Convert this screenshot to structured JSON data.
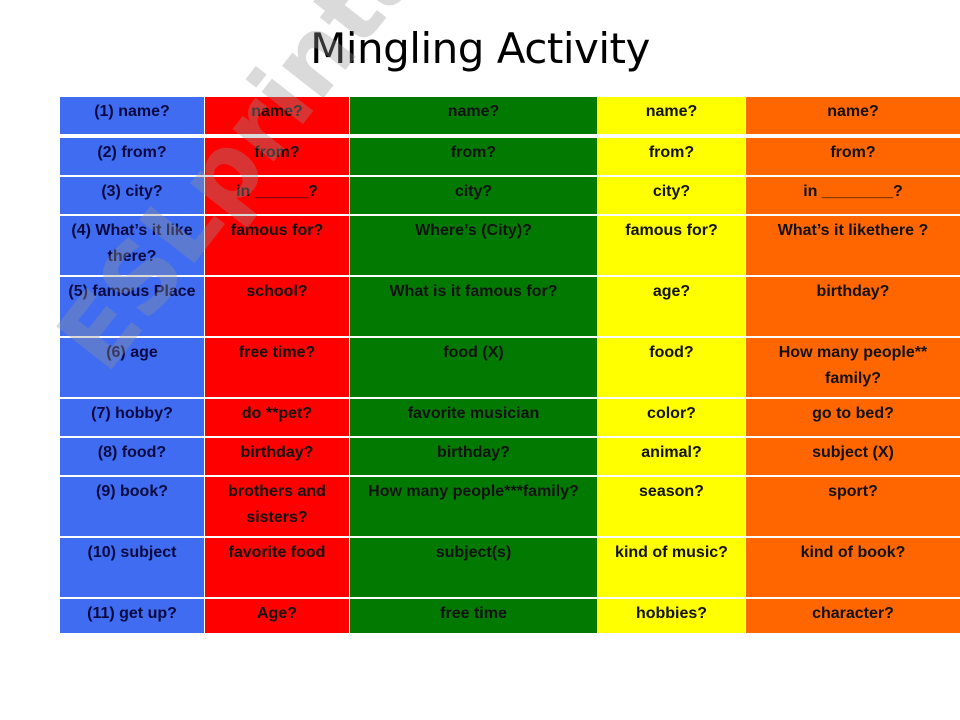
{
  "title": "Mingling Activity",
  "watermark": "ESLprintables.com",
  "colors": {
    "column_1": "#3f6cf1",
    "column_2": "#fe0000",
    "column_3": "#027a02",
    "column_4": "#ffff00",
    "column_5": "#ff6600"
  },
  "table": {
    "rows": [
      [
        "(1) name?",
        "name?",
        "name?",
        "name?",
        "name?"
      ],
      [
        "(2) from?",
        "from?",
        "from?",
        "from?",
        "from?"
      ],
      [
        "(3) city?",
        "in ______?",
        "city?",
        "city?",
        "in ________?"
      ],
      [
        "(4) What’s it like there?",
        "famous for?",
        "Where’s (City)?",
        "famous for?",
        "What’s it likethere  ?"
      ],
      [
        "(5) famous Place",
        "school?",
        "What is it famous for?",
        "age?",
        "birthday?"
      ],
      [
        "(6) age",
        "free time?",
        "food (X)",
        "food?",
        "How many people** family?"
      ],
      [
        "(7) hobby?",
        "do **pet?",
        "favorite musician",
        "color?",
        "go to bed?"
      ],
      [
        "(8) food?",
        "birthday?",
        "birthday?",
        "animal?",
        "subject (X)"
      ],
      [
        "(9) book?",
        "brothers and sisters?",
        "How many people***family?",
        "season?",
        "sport?"
      ],
      [
        "(10) subject",
        "favorite food",
        "subject(s)",
        "kind of music?",
        "kind of book?"
      ],
      [
        "(11) get up?",
        "Age?",
        "free time",
        "hobbies?",
        "character?"
      ]
    ]
  }
}
